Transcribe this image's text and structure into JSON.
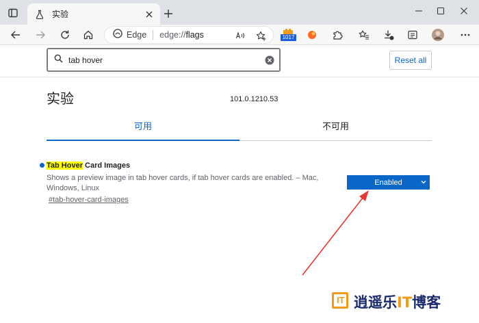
{
  "browser": {
    "tab_title": "实验",
    "omnibox": {
      "brand": "Edge",
      "url_scheme": "edge://",
      "url_path": "flags"
    },
    "extension_badge": "1017"
  },
  "search": {
    "value": "tab hover",
    "reset_label": "Reset all"
  },
  "page": {
    "title": "实验",
    "version": "101.0.1210.53",
    "tabs": [
      {
        "label": "可用",
        "active": true
      },
      {
        "label": "不可用",
        "active": false
      }
    ]
  },
  "flag": {
    "name_highlight": "Tab Hover",
    "name_rest": " Card Images",
    "description": "Shows a preview image in tab hover cards, if tab hover cards are enabled. – Mac, Windows, Linux",
    "link": "#tab-hover-card-images",
    "selected_option": "Enabled"
  },
  "watermark": {
    "logo_text": "IT",
    "text_a": "逍遥乐",
    "text_b": "IT",
    "text_c": "博客"
  },
  "colors": {
    "accent": "#0a67c7",
    "highlight": "#ffff00",
    "arrow": "#e53935"
  }
}
